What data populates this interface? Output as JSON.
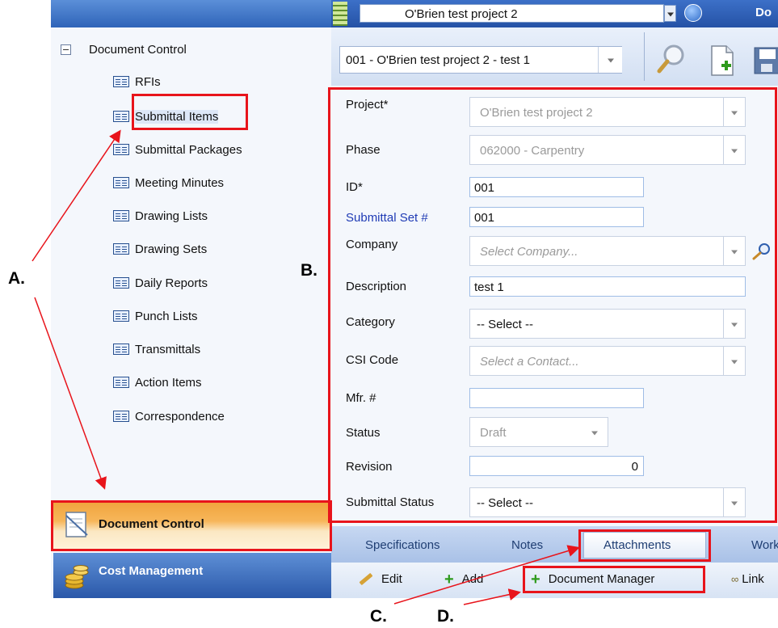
{
  "header": {
    "project_selected": "O'Brien test project 2",
    "title_fragment": "Do"
  },
  "toolbar": {
    "record_selected": "001 - O'Brien test project 2 - test 1"
  },
  "tree": {
    "root_label": "Document Control",
    "items": [
      {
        "label": "RFIs"
      },
      {
        "label": "Submittal Items"
      },
      {
        "label": "Submittal Packages"
      },
      {
        "label": "Meeting Minutes"
      },
      {
        "label": "Drawing Lists"
      },
      {
        "label": "Drawing Sets"
      },
      {
        "label": "Daily Reports"
      },
      {
        "label": "Punch Lists"
      },
      {
        "label": "Transmittals"
      },
      {
        "label": "Action Items"
      },
      {
        "label": "Correspondence"
      }
    ]
  },
  "nav": {
    "document_control": "Document Control",
    "cost_management": "Cost Management"
  },
  "form": {
    "project": {
      "label": "Project*",
      "value": "O'Brien test project 2"
    },
    "phase": {
      "label": "Phase",
      "value": "062000 - Carpentry"
    },
    "id": {
      "label": "ID*",
      "value": "001"
    },
    "submittal_set": {
      "label": "Submittal Set #",
      "value": "001"
    },
    "company": {
      "label": "Company",
      "placeholder": "Select Company..."
    },
    "description": {
      "label": "Description",
      "value": "test 1"
    },
    "category": {
      "label": "Category",
      "value": "-- Select --"
    },
    "csi_code": {
      "label": "CSI Code",
      "placeholder": "Select a Contact..."
    },
    "mfr": {
      "label": "Mfr. #",
      "value": ""
    },
    "status": {
      "label": "Status",
      "value": "Draft"
    },
    "revision": {
      "label": "Revision",
      "value": "0"
    },
    "submittal_status": {
      "label": "Submittal Status",
      "value": "-- Select --"
    }
  },
  "tabs": [
    "Specifications",
    "Notes",
    "Attachments",
    "Workf"
  ],
  "actions": {
    "edit": "Edit",
    "add": "Add",
    "document_manager": "Document Manager",
    "link": "Link"
  },
  "annotations": {
    "a": "A.",
    "b": "B.",
    "c": "C.",
    "d": "D."
  },
  "colors": {
    "highlight": "#e8141b",
    "accent_orange": "#f0a43c",
    "header_blue": "#2f64b9",
    "link_blue": "#1f3bb5"
  }
}
